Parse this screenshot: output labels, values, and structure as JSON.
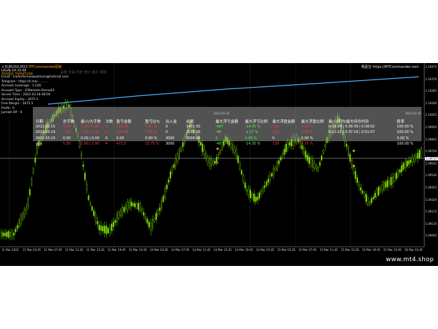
{
  "window": {
    "symbol_title": "EURUSD,M15",
    "indicator_title": "MTCommander促销",
    "right_label": "我盈宝 https://MTCommander.com"
  },
  "ea": {
    "prefix": "LEGAL EA V2.00",
    "name": "TRADER TAPAKTUAN",
    "info_lines": [
      "Email : traderforexkepaktuan@hotmail.com",
      "Telegram : https://t.me/..........",
      "Account Leverage : 1:100",
      "Account Type : ICMarkets-Demo03",
      "Server Time : 2022.03.16 06:04",
      "Account Equity : 3472.5",
      "Free Margin : 3472.5",
      "Profit : 0",
      "Jumlah OP : 0"
    ],
    "faded_menu": "设置 交易 历史 统计 账户 帮助"
  },
  "stats": {
    "mini_left": "2022.03.16",
    "mini_right": "2022.03.16",
    "headers": [
      "日期",
      "总手数",
      "最小/大手数",
      "次数",
      "盈亏金额",
      "盈亏比%",
      "出入金",
      "余额",
      "最大浮亏金额",
      "最大浮亏比例",
      "最大浮盈金额",
      "最大浮盈比例",
      "最小/平均/最大持仓时间",
      "胜率"
    ],
    "rows": [
      [
        "2022.03.15",
        "3.50",
        "1.00 | 1.90",
        "2",
        "234.56",
        "7.24 %",
        "0",
        "3472.50",
        "-487",
        "-14.35 %",
        "139",
        "4.15 %",
        "0:16:34 | 0:39:39 | 0:38:02",
        "100.00 %"
      ],
      [
        "2022.03.14",
        "2.00",
        "1.00 | 1.90",
        "2",
        "235.66",
        "7.83 %",
        "0",
        "3238.00",
        "-48",
        "-1.57 %",
        "132",
        "3.80 %",
        "0:22:10 | 0:37:16 | 0:51:57",
        "100.00 %"
      ],
      [
        "2022.03.10",
        "0.00",
        "0.00 | 0.00",
        "0",
        "0.00",
        "0.00 %",
        "3000",
        "3000.00",
        "0",
        "0.00 %",
        "0",
        "0.00 %",
        "",
        "0.00 %"
      ],
      [
        "合计",
        "5.50",
        "1.00 | 1.90",
        "4",
        "472.5",
        "15.75 %",
        "3000",
        "",
        "-487",
        "-14.35 %",
        "139",
        "4.15 %",
        "",
        "100.00 %"
      ]
    ]
  },
  "price_axis": [
    "1.10475",
    "1.10370",
    "1.10265",
    "1.10160",
    "1.10055",
    "1.09950",
    "1.09845",
    "1.09740",
    "1.09635",
    "1.09530",
    "1.09425",
    "1.09320",
    "1.09215",
    "1.09110",
    "1.09005"
  ],
  "current_price": "1.09717",
  "time_axis": [
    "11 Mar 2022",
    "11 Mar 03:45",
    "11 Mar 07:45",
    "11 Mar 11:45",
    "11 Mar 15:45",
    "11 Mar 19:45",
    "11 Mar 23:45",
    "14 Mar 03:45",
    "14 Mar 07:45",
    "14 Mar 11:45",
    "14 Mar 15:45",
    "14 Mar 19:45",
    "14 Mar 23:45",
    "15 Mar 03:45",
    "15 Mar 07:45",
    "15 Mar 11:45",
    "15 Mar 15:45",
    "15 Mar 19:45",
    "15 Mar 23:45",
    "16 Mar 03:45"
  ],
  "watermark": "www.mt4.shop",
  "colors": {
    "candle": "#7fe000",
    "equity_line": "#4fb3ff",
    "background": "#000000"
  }
}
